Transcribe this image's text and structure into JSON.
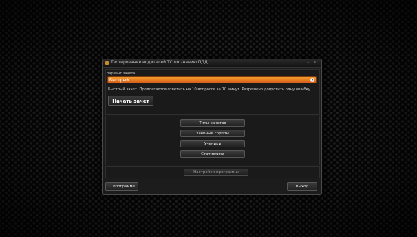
{
  "window": {
    "title": "Тестирование водителей ТС по знанию ПДД",
    "controls": "– ×"
  },
  "mode": {
    "label": "Вариант зачета",
    "selected": "Быстрый"
  },
  "description": "Быстрый зачет. Предлагается ответить на 10 вопросов за 10 минут. Разрешено допустить одну ошибку.",
  "start_button": "Начать зачет",
  "menu": {
    "items": [
      {
        "label": "Типы зачетов"
      },
      {
        "label": "Учебные группы"
      },
      {
        "label": "Ученики"
      },
      {
        "label": "Статистика"
      }
    ]
  },
  "settings_button": "Настройки программы",
  "footer": {
    "about": "О программе",
    "exit": "Выход"
  }
}
